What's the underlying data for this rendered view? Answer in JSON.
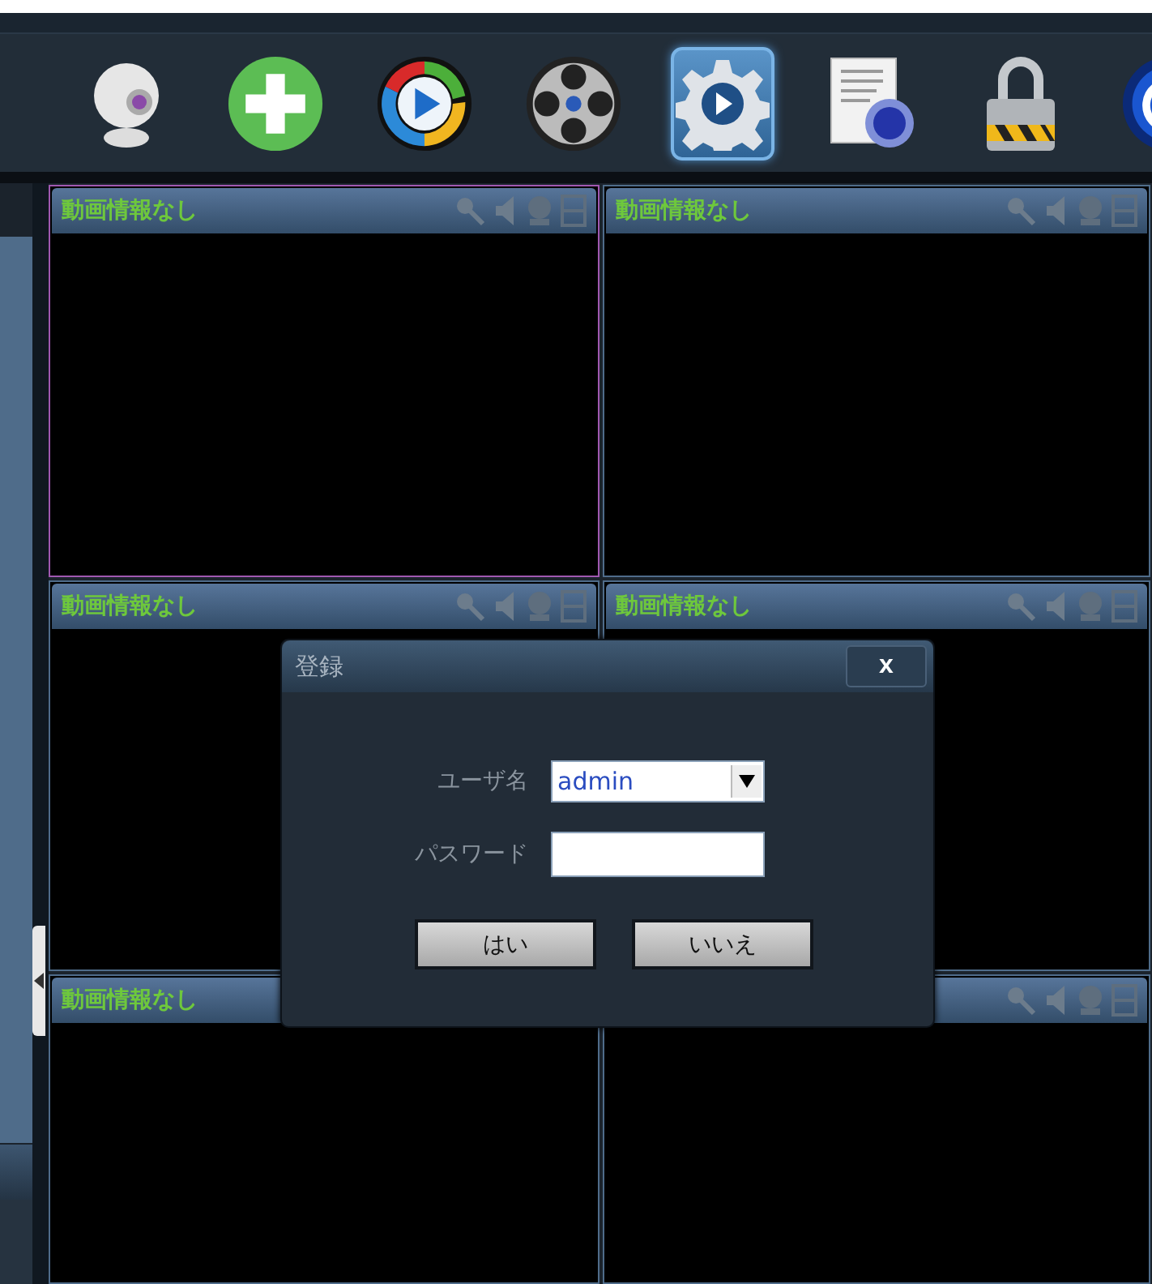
{
  "toolbar": [
    {
      "kind": "webcam",
      "selected": false
    },
    {
      "kind": "add",
      "selected": false
    },
    {
      "kind": "play",
      "selected": false
    },
    {
      "kind": "reel",
      "selected": false
    },
    {
      "kind": "settings",
      "selected": true
    },
    {
      "kind": "document",
      "selected": false
    },
    {
      "kind": "lock",
      "selected": false
    },
    {
      "kind": "power",
      "selected": false
    }
  ],
  "video_cells": [
    {
      "title": "動画情報なし",
      "selected": true
    },
    {
      "title": "動画情報なし",
      "selected": false
    },
    {
      "title": "動画情報なし",
      "selected": false
    },
    {
      "title": "動画情報なし",
      "selected": false
    },
    {
      "title": "動画情報なし",
      "selected": false
    },
    {
      "selected": false
    }
  ],
  "login_dialog": {
    "title": "登録",
    "close": "x",
    "username_label": "ユーザ名",
    "username_value": "admin",
    "password_label": "パスワード",
    "buttons": [
      "はい",
      "いいえ"
    ]
  }
}
